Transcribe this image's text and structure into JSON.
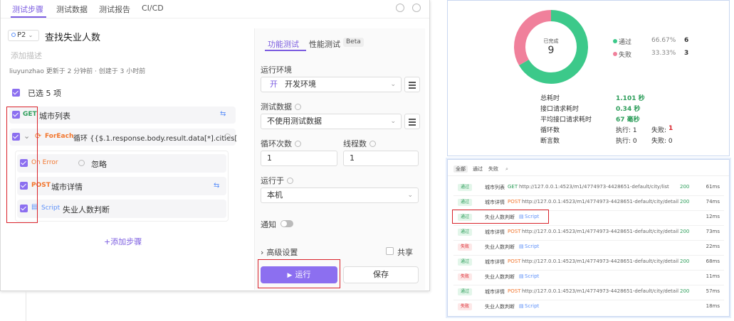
{
  "left": {
    "tabs": [
      "测试步骤",
      "测试数据",
      "测试报告",
      "CI/CD"
    ],
    "priority": "P2",
    "case_title": "查找失业人数",
    "description_placeholder": "添加描述",
    "meta": "liuyunzhao 更新于 2 分钟前 · 创建于 3 小时前",
    "selected": "已选 5 项",
    "steps": [
      {
        "method": "GET",
        "name": "城市列表"
      },
      {
        "method": "ForEach",
        "name": "循环 {{$.1.response.body.result.data[*].cities["
      },
      {
        "method": "On Error",
        "name": "忽略"
      },
      {
        "method": "POST",
        "name": "城市详情"
      },
      {
        "method": "Script",
        "name": "失业人数判断"
      }
    ],
    "add_step": "添加步骤"
  },
  "config": {
    "tabs": [
      "功能测试",
      "性能测试"
    ],
    "beta": "Beta",
    "env_label": "运行环境",
    "env_badge": "开",
    "env_value": "开发环境",
    "data_label": "测试数据",
    "data_value": "不使用测试数据",
    "loop_label": "循环次数",
    "loop_value": "1",
    "thread_label": "线程数",
    "thread_value": "1",
    "run_on_label": "运行于",
    "run_on_value": "本机",
    "notify_label": "通知",
    "advanced_label": "高级设置",
    "share_label": "共享",
    "run_button": "运行",
    "save_button": "保存"
  },
  "summary": {
    "center_label": "已完成",
    "center_value": "9",
    "legend": [
      {
        "label": "通过",
        "pct": "66.67%",
        "count": "6",
        "color": "#3cc98a"
      },
      {
        "label": "失败",
        "pct": "33.33%",
        "count": "3",
        "color": "#f0809b"
      }
    ],
    "stats": [
      {
        "label": "总耗时",
        "value": "1.101 秒"
      },
      {
        "label": "接口请求耗时",
        "value": "0.34 秒"
      },
      {
        "label": "平均接口请求耗时",
        "value": "67 毫秒"
      },
      {
        "label": "循环数",
        "value": "执行: 1",
        "extra": "失败: ",
        "extra_val": "1"
      },
      {
        "label": "断言数",
        "value": "执行: 0",
        "extra": "失败: 0",
        "extra_val": ""
      }
    ],
    "chart_data": {
      "type": "pie",
      "categories": [
        "通过",
        "失败"
      ],
      "values": [
        6,
        3
      ]
    }
  },
  "results": {
    "filters": [
      "全部",
      "通过",
      "失败"
    ],
    "rows": [
      {
        "status": "通过",
        "name": "城市列表",
        "method": "GET",
        "url": "http://127.0.0.1:4523/m1/4774973-4428651-default/city/list",
        "code": "200",
        "time": "61ms"
      },
      {
        "status": "通过",
        "name": "城市详情",
        "method": "POST",
        "url": "http://127.0.0.1:4523/m1/4774973-4428651-default/city/detail",
        "code": "200",
        "time": "74ms"
      },
      {
        "status": "通过",
        "name": "失业人数判断",
        "method": "Script",
        "url": "",
        "code": "",
        "time": "12ms"
      },
      {
        "status": "通过",
        "name": "城市详情",
        "method": "POST",
        "url": "http://127.0.0.1:4523/m1/4774973-4428651-default/city/detail",
        "code": "200",
        "time": "73ms"
      },
      {
        "status": "失败",
        "name": "失业人数判断",
        "method": "Script",
        "url": "",
        "code": "",
        "time": "22ms"
      },
      {
        "status": "通过",
        "name": "城市详情",
        "method": "POST",
        "url": "http://127.0.0.1:4523/m1/4774973-4428651-default/city/detail",
        "code": "200",
        "time": "68ms"
      },
      {
        "status": "失败",
        "name": "失业人数判断",
        "method": "Script",
        "url": "",
        "code": "",
        "time": "11ms"
      },
      {
        "status": "通过",
        "name": "城市详情",
        "method": "POST",
        "url": "http://127.0.0.1:4523/m1/4774973-4428651-default/city/detail",
        "code": "200",
        "time": "57ms"
      },
      {
        "status": "失败",
        "name": "失业人数判断",
        "method": "Script",
        "url": "",
        "code": "",
        "time": "18ms"
      }
    ]
  }
}
